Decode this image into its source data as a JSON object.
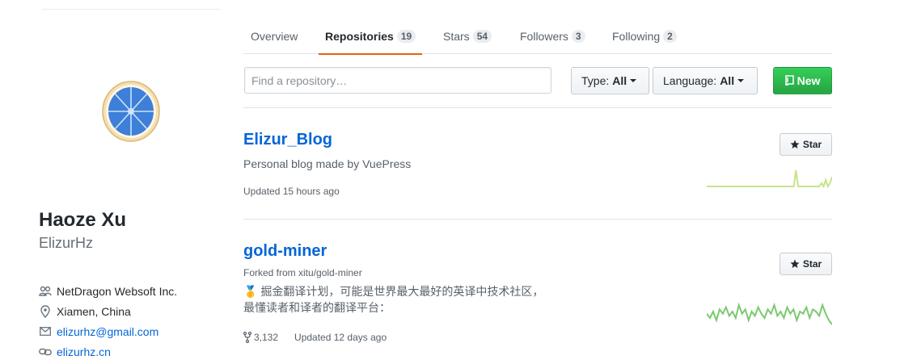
{
  "profile": {
    "fullname": "Haoze Xu",
    "username": "ElizurHz",
    "company": "NetDragon Websoft Inc.",
    "location": "Xiamen, China",
    "email": "elizurhz@gmail.com",
    "website": "elizurhz.cn"
  },
  "tabs": [
    {
      "label": "Overview",
      "count": null
    },
    {
      "label": "Repositories",
      "count": "19",
      "selected": true
    },
    {
      "label": "Stars",
      "count": "54"
    },
    {
      "label": "Followers",
      "count": "3"
    },
    {
      "label": "Following",
      "count": "2"
    }
  ],
  "filter": {
    "search_placeholder": "Find a repository…",
    "type_label": "Type:",
    "type_value": "All",
    "language_label": "Language:",
    "language_value": "All",
    "new_label": "New"
  },
  "repos": [
    {
      "name": "Elizur_Blog",
      "description": "Personal blog made by VuePress",
      "updated": "Updated 15 hours ago",
      "star_label": "Star",
      "activity": [
        1,
        1,
        1,
        1,
        1,
        1,
        1,
        1,
        1,
        1,
        1,
        1,
        1,
        1,
        1,
        1,
        1,
        1,
        1,
        1,
        1,
        1,
        1,
        1,
        1,
        1,
        1,
        1,
        1,
        1,
        1,
        1,
        1,
        1,
        1,
        1,
        1,
        1,
        1,
        1,
        1,
        1,
        6,
        1,
        1,
        1,
        1,
        1,
        1,
        1,
        1,
        1,
        1,
        1,
        2,
        1,
        3,
        1,
        2,
        4
      ]
    },
    {
      "name": "gold-miner",
      "forked_from": "Forked from xitu/gold-miner",
      "description_emoji": "🥇",
      "description_line1": "掘金翻译计划，可能是世界最大最好的英译中技术社区，",
      "description_line2": "最懂读者和译者的翻译平台：",
      "forks": "3,132",
      "updated": "Updated 12 days ago",
      "star_label": "Star",
      "activity": [
        5,
        3,
        6,
        2,
        7,
        5,
        8,
        4,
        6,
        3,
        9,
        5,
        7,
        2,
        6,
        4,
        8,
        5,
        3,
        7,
        5,
        9,
        4,
        6,
        3,
        8,
        5,
        7,
        2,
        6,
        5,
        8,
        3,
        7,
        6,
        4,
        9,
        5,
        2,
        0
      ]
    }
  ],
  "colors": {
    "link": "#0366d6",
    "accent_tab": "#e36209",
    "new_button": "#28a745",
    "spark_light": "#c6e48b",
    "spark_dark": "#7bc96f"
  }
}
